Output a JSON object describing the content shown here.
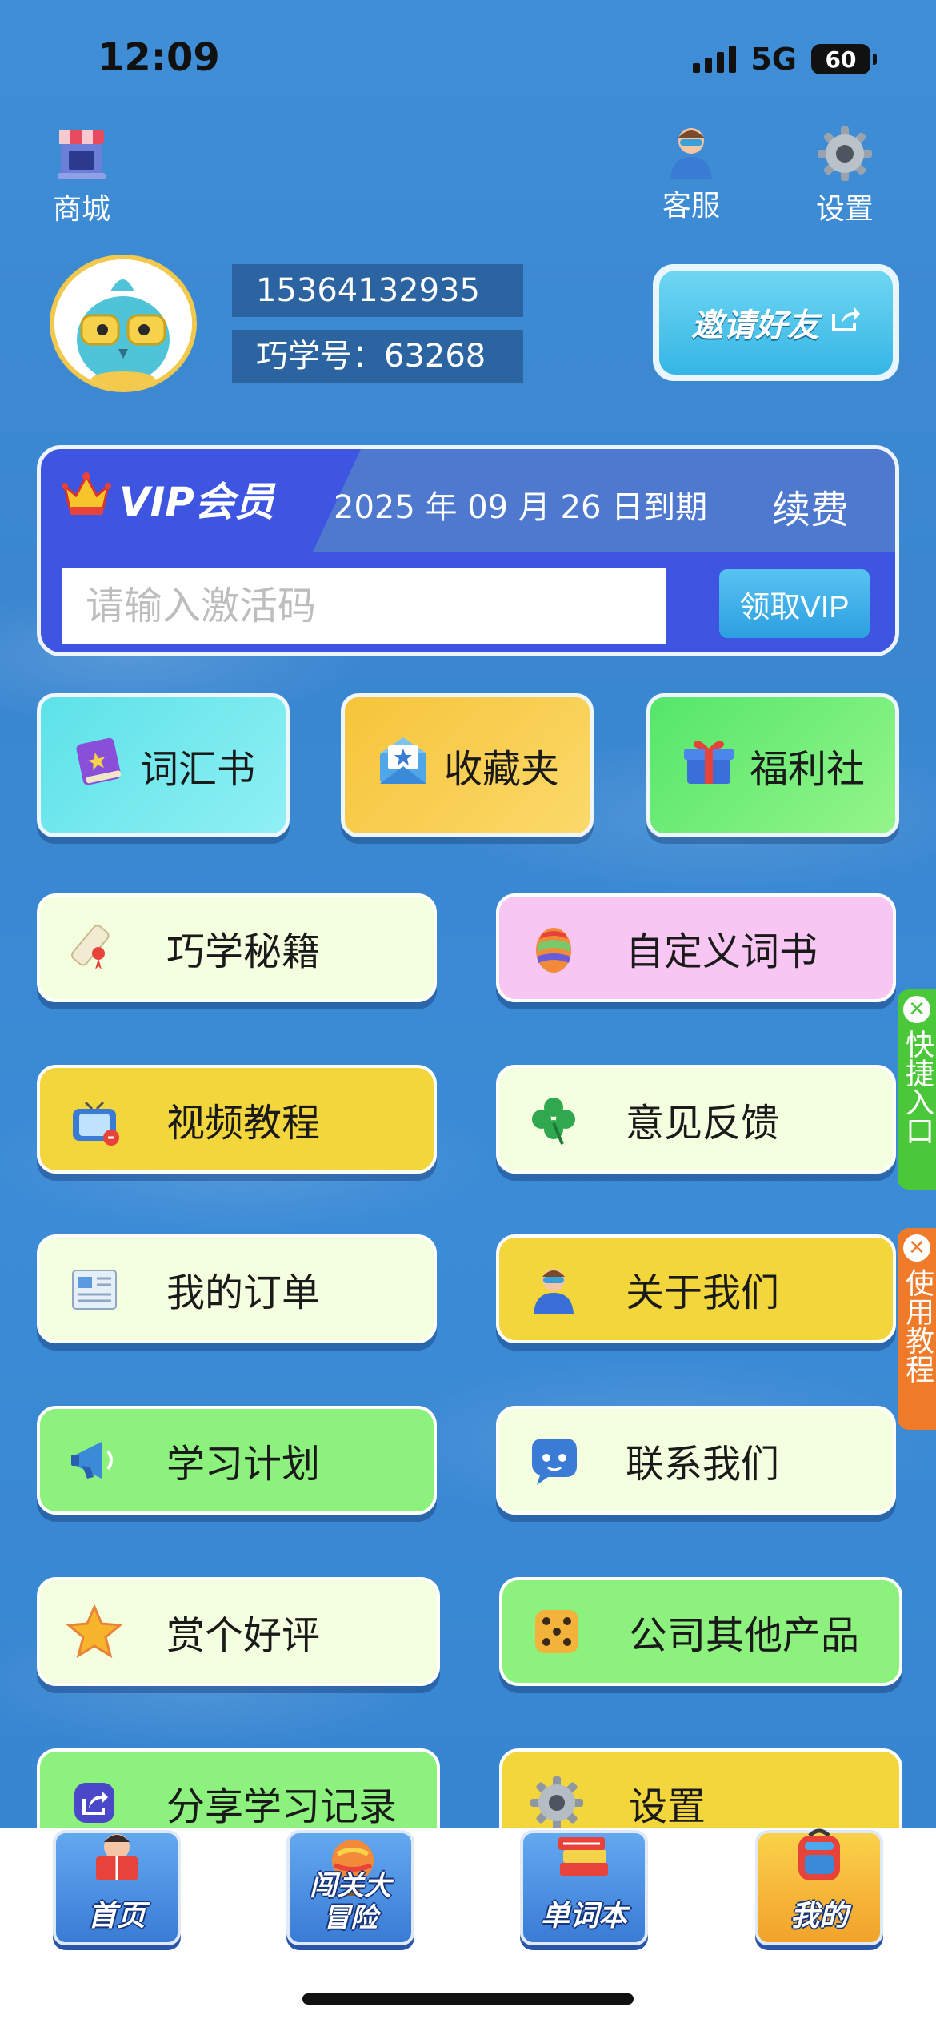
{
  "status_bar": {
    "time": "12:09",
    "network": "5G",
    "battery": "60"
  },
  "top_bar": {
    "mall": "商城",
    "service": "客服",
    "settings": "设置"
  },
  "profile": {
    "phone": "15364132935",
    "student_id": "巧学号：63268",
    "invite_label": "邀请好友"
  },
  "vip": {
    "title": "VIP会员",
    "expire": "2025 年 09 月 26 日到期",
    "renew": "续费",
    "input_placeholder": "请输入激活码",
    "claim_button": "领取VIP"
  },
  "quick": [
    {
      "label": "词汇书",
      "icon": "book-icon"
    },
    {
      "label": "收藏夹",
      "icon": "favorite-mail-icon"
    },
    {
      "label": "福利社",
      "icon": "gift-icon"
    }
  ],
  "menu": [
    {
      "label": "巧学秘籍",
      "icon": "scroll-icon",
      "color": "#f4ffdf"
    },
    {
      "label": "自定义词书",
      "icon": "egg-icon",
      "color": "#f8c6f3"
    },
    {
      "label": "视频教程",
      "icon": "tv-icon",
      "color": "#f3d63c"
    },
    {
      "label": "意见反馈",
      "icon": "clover-icon",
      "color": "#f4ffdf"
    },
    {
      "label": "我的订单",
      "icon": "newspaper-icon",
      "color": "#f4ffdf"
    },
    {
      "label": "关于我们",
      "icon": "person-icon",
      "color": "#f3d63c"
    },
    {
      "label": "学习计划",
      "icon": "megaphone-icon",
      "color": "#8cf27d"
    },
    {
      "label": "联系我们",
      "icon": "chat-bubble-icon",
      "color": "#f4ffdf"
    },
    {
      "label": "赏个好评",
      "icon": "star-icon",
      "color": "#f4ffdf"
    },
    {
      "label": "公司其他产品",
      "icon": "dice-icon",
      "color": "#8cf27d"
    },
    {
      "label": "分享学习记录",
      "icon": "share-icon",
      "color": "#8cf27d"
    },
    {
      "label": "设置",
      "icon": "gear-icon",
      "color": "#f3d63c"
    }
  ],
  "side_tabs": {
    "shortcut": "快捷入口",
    "tutorial": "使用教程"
  },
  "bottom_nav": [
    {
      "label": "首页"
    },
    {
      "label": "闯关大冒险"
    },
    {
      "label": "单词本"
    },
    {
      "label": "我的"
    }
  ]
}
